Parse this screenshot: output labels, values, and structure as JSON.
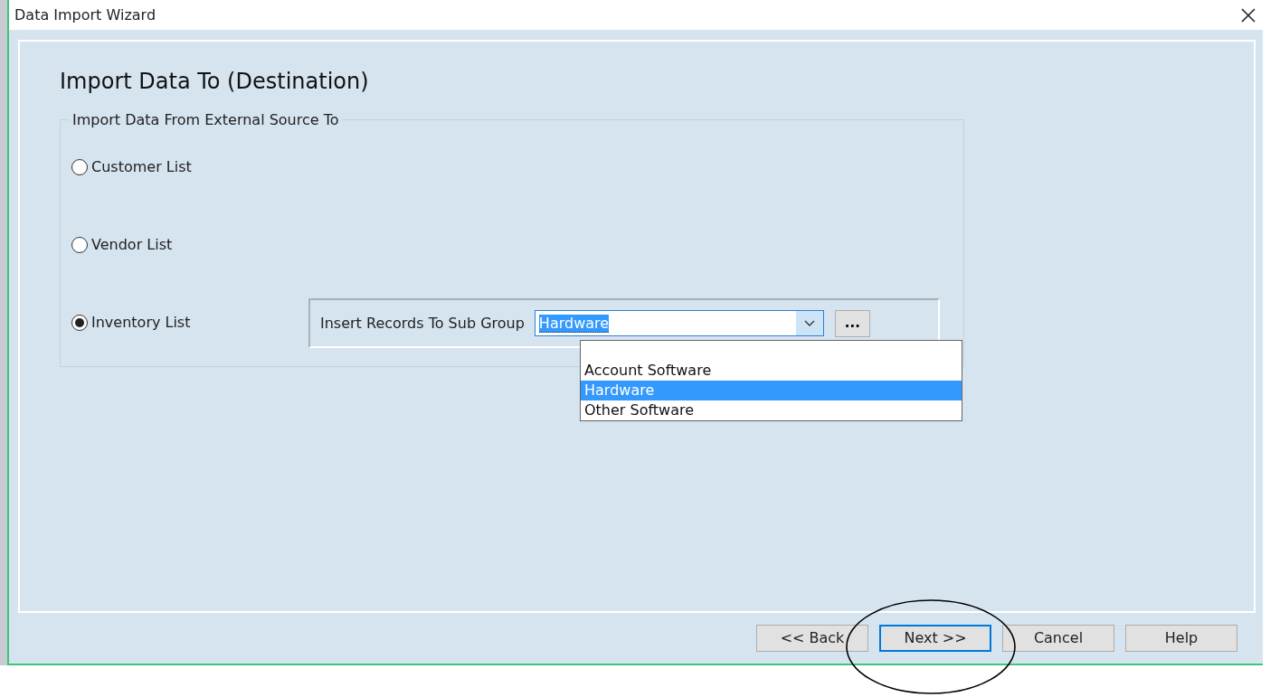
{
  "window": {
    "title": "Data Import Wizard"
  },
  "heading": "Import Data To (Destination)",
  "group": {
    "legend": "Import Data From External Source To",
    "options": [
      {
        "label": "Customer List",
        "selected": false
      },
      {
        "label": "Vendor List",
        "selected": false
      },
      {
        "label": "Inventory List",
        "selected": true
      }
    ]
  },
  "sub_group": {
    "label": "Insert Records To Sub Group",
    "value": "Hardware",
    "browse": "...",
    "expanded": true,
    "options": [
      {
        "label": "Account Software",
        "selected": false
      },
      {
        "label": "Hardware",
        "selected": true
      },
      {
        "label": "Other Software",
        "selected": false
      }
    ]
  },
  "buttons": [
    {
      "label": "<< Back",
      "selected": false
    },
    {
      "label": "Next >>",
      "selected": true
    },
    {
      "label": "Cancel",
      "selected": false
    },
    {
      "label": "Help",
      "selected": false
    }
  ],
  "annotation": {
    "kind": "ellipse"
  }
}
